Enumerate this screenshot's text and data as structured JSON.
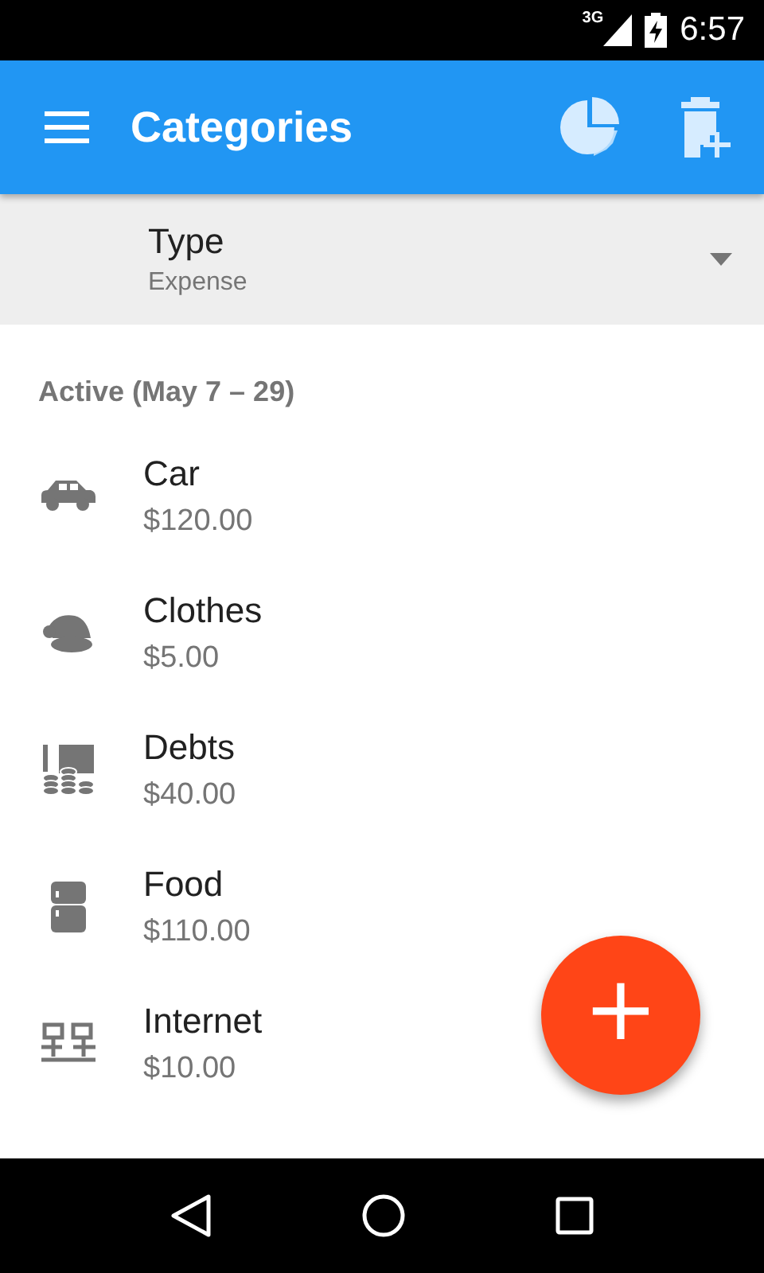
{
  "status_bar": {
    "network": "3G",
    "time": "6:57"
  },
  "app_bar": {
    "title": "Categories"
  },
  "type_filter": {
    "label": "Type",
    "value": "Expense"
  },
  "section": {
    "title": "Active (May 7 – 29)"
  },
  "categories": [
    {
      "kind": "car",
      "name": "Car",
      "amount": "$120.00"
    },
    {
      "kind": "hat",
      "name": "Clothes",
      "amount": "$5.00"
    },
    {
      "kind": "coins",
      "name": "Debts",
      "amount": "$40.00"
    },
    {
      "kind": "fridge",
      "name": "Food",
      "amount": "$110.00"
    },
    {
      "kind": "network",
      "name": "Internet",
      "amount": "$10.00"
    }
  ],
  "fab": {
    "label": "+"
  }
}
